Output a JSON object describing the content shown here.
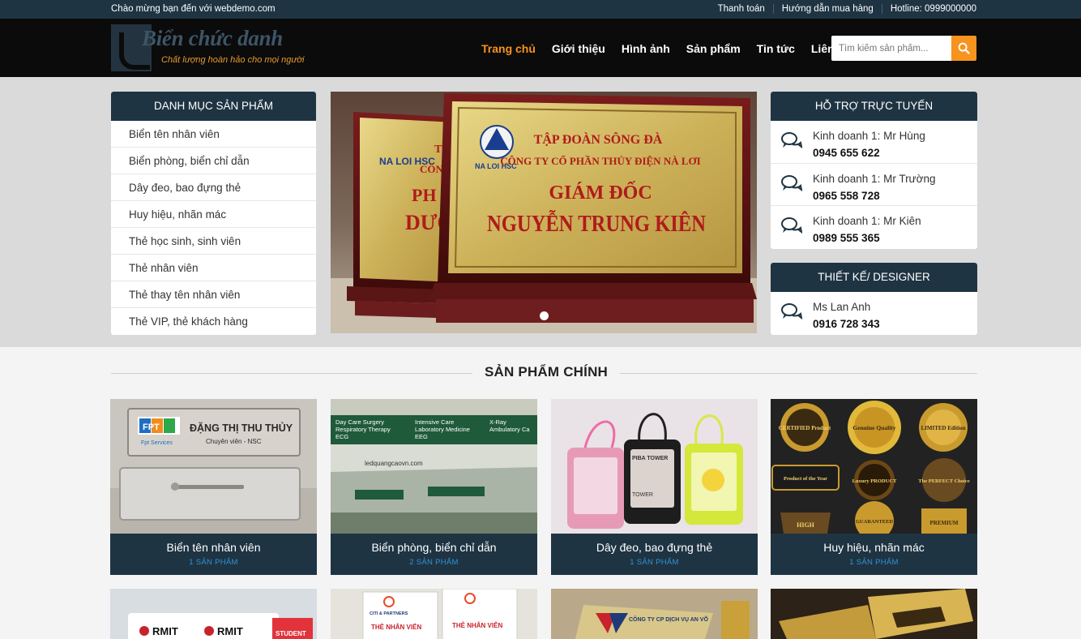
{
  "topbar": {
    "welcome": "Chào mừng bạn đến với webdemo.com",
    "links": [
      "Thanh toán",
      "Hướng dẫn mua hàng",
      "Hotline: 0999000000"
    ]
  },
  "logo": {
    "title": "Biển chức danh",
    "slogan": "Chất lượng hoàn hảo cho mọi người"
  },
  "nav": {
    "items": [
      "Trang chủ",
      "Giới thiệu",
      "Hình ảnh",
      "Sản phẩm",
      "Tin tức",
      "Liên hệ"
    ],
    "active_index": 0
  },
  "search": {
    "placeholder": "Tìm kiếm sản phẩm..."
  },
  "categories": {
    "title": "DANH MỤC SẢN PHẨM",
    "items": [
      "Biển tên nhân viên",
      "Biển phòng, biển chỉ dẫn",
      "Dây đeo, bao đựng thẻ",
      "Huy hiệu, nhãn mác",
      "Thẻ học sinh, sinh viên",
      "Thẻ nhân viên",
      "Thẻ thay tên nhân viên",
      "Thẻ VIP, thẻ khách hàng"
    ]
  },
  "slider": {
    "plaque_back": {
      "line1": "TẬ",
      "line2": "CÔNG T",
      "line3": "PH",
      "line4": "DƯƠ",
      "brand": "NA LOI HSC"
    },
    "plaque_front": {
      "line1": "TẬP ĐOÀN SÔNG ĐÀ",
      "line2": "CÔNG TY CỔ PHẦN THỦY ĐIỆN NÀ LƠI",
      "line3": "GIÁM ĐỐC",
      "line4": "NGUYỄN TRUNG KIÊN",
      "brand": "NA LOI HSC"
    }
  },
  "support": {
    "title": "HỖ TRỢ TRỰC TUYẾN",
    "contacts": [
      {
        "name": "Kinh doanh 1: Mr Hùng",
        "phone": "0945 655 622"
      },
      {
        "name": "Kinh doanh 1: Mr Trường",
        "phone": "0965 558 728"
      },
      {
        "name": "Kinh doanh 1: Mr Kiên",
        "phone": "0989 555 365"
      }
    ]
  },
  "designer": {
    "title": "THIẾT KẾ/ DESIGNER",
    "contacts": [
      {
        "name": "Ms Lan Anh",
        "phone": "0916 728 343"
      }
    ]
  },
  "main_section": {
    "title": "SẢN PHẨM CHÍNH"
  },
  "products": [
    {
      "name": "Biển tên nhân viên",
      "count": "1 SẢN PHẨM",
      "img": {
        "logo": "FPT",
        "logo_sub": "Fpt Services",
        "name": "ĐẶNG THỊ THU THỦY",
        "role": "Chuyên viên - NSC"
      }
    },
    {
      "name": "Biển phòng, biển chỉ dẫn",
      "count": "2 SẢN PHẨM",
      "img": {
        "signs": [
          "Day Care Surgery",
          "Respiratory Therapy",
          "ECG",
          "Intensive Care",
          "Laboratory Medicine",
          "EEG",
          "X-Ray",
          "Ambulatory Ca"
        ],
        "watermark": "ledquangcaovn.com"
      }
    },
    {
      "name": "Dây đeo, bao đựng thẻ",
      "count": "1 SẢN PHẨM",
      "img": {
        "tag": "PIBA TOWER",
        "tag2": "TOWER"
      }
    },
    {
      "name": "Huy hiệu, nhãn mác",
      "count": "1 SẢN PHẨM",
      "img": {
        "badges": [
          "CERTIFIED Product",
          "Genuine Quality",
          "LIMITED Edition",
          "Product of the Year",
          "Luxury PRODUCT",
          "The PERFECT Choice",
          "HIGH",
          "GUARANTEED",
          "PREMIUM"
        ]
      }
    }
  ],
  "products_row2": [
    {
      "img": {
        "text1": "RMIT",
        "text2": "RMIT",
        "text3": "STUDENT"
      }
    },
    {
      "img": {
        "text1": "CITI & PARTNERS",
        "text2": "THẺ NHÂN VIÊN",
        "text3": "THẺ NHÂN VIÊN"
      }
    },
    {
      "img": {
        "text1": "CÔNG TY CP DỊCH VỤ AN VÕ"
      }
    },
    {
      "img": {}
    }
  ],
  "colors": {
    "navy": "#1f3443",
    "accent": "#f7931e",
    "count_blue": "#2e93d2"
  }
}
